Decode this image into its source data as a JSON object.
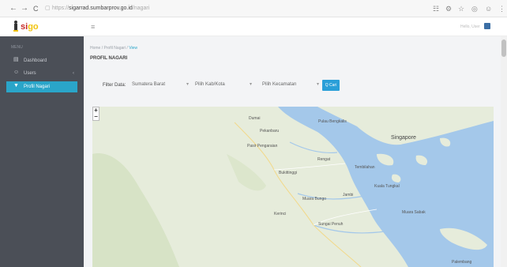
{
  "browser": {
    "url_proto": "https://",
    "url_host": "sigarrad.sumbarprov.go.id",
    "url_path": "/nagari",
    "back": "←",
    "forward": "→",
    "reload": "C"
  },
  "logo": {
    "part_a": "si",
    "part_b": "go"
  },
  "header": {
    "menu_toggle": "≡",
    "user_label": "Hello, User"
  },
  "sidebar": {
    "section_label": "MENU",
    "items": [
      {
        "label": "Dashboard",
        "icon": "dashboard-icon"
      },
      {
        "label": "Users",
        "icon": "user-icon"
      },
      {
        "label": "Profil Nagari",
        "icon": "map-marker-icon"
      }
    ]
  },
  "breadcrumb": {
    "home": "Home",
    "mid": "Profil Nagari",
    "current": "View"
  },
  "page": {
    "title": "PROFIL NAGARI"
  },
  "filter": {
    "label": "Filter Data:",
    "province": "Sumatera Barat",
    "kab": "Pilih Kab/Kota",
    "kec": "Pilih Kecamatan",
    "button": "Q Cari"
  },
  "map": {
    "zoom_in": "+",
    "zoom_out": "−",
    "places": [
      "Pekanbaru",
      "Singapore",
      "Dumai",
      "Pulau Bengkalis",
      "Pasir Pengaraian",
      "Rengat",
      "Tembilahan",
      "Jambi",
      "Muara Sabak",
      "Palembang",
      "Kuala Tungkal",
      "Kerinci",
      "Sungai Penuh",
      "Muara Bungo",
      "Bukittinggi"
    ]
  },
  "colors": {
    "sidebar": "#4b4f57",
    "accent": "#2aa5c9",
    "sea": "#a4c8ea",
    "land": "#e6ecdb"
  }
}
